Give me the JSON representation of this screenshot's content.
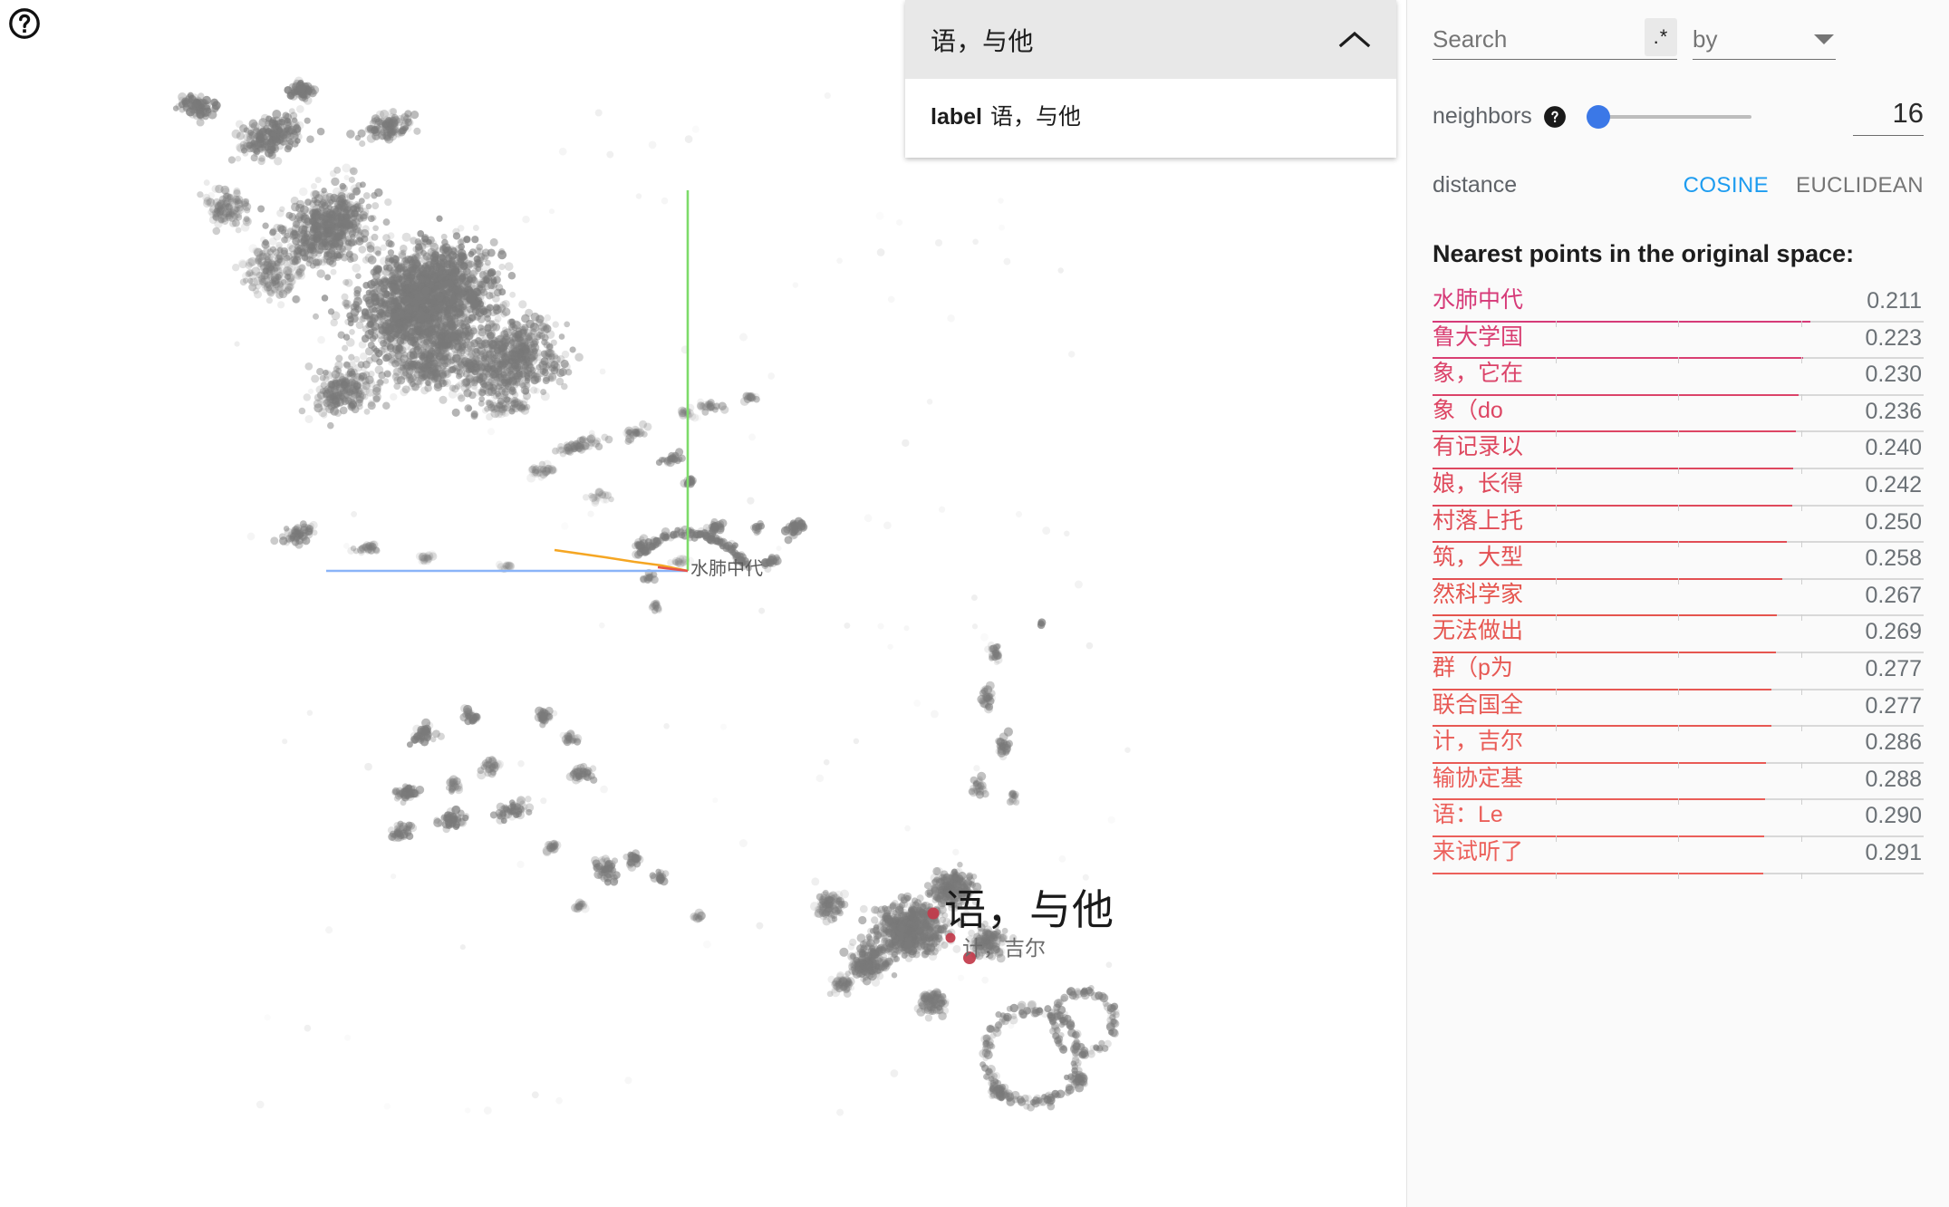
{
  "canvas": {
    "help_icon": "help-circle-icon",
    "selected_point_label": "语，与他",
    "neighbor_point_label": "计，吉尔",
    "axis_origin_label": "水肺中代",
    "axis_colors": {
      "x": "#8ab4f8",
      "y": "#7ddb6a",
      "z": "#f5a623"
    },
    "point_color": "#7a7a7a",
    "highlight_color": "#c2394a"
  },
  "metadata_card": {
    "title": "语，与他",
    "collapse_icon": "chevron-up-icon",
    "rows": [
      {
        "key": "label",
        "value": "语，与他"
      }
    ]
  },
  "sidebar": {
    "search": {
      "placeholder": "Search",
      "value": "",
      "regex_label": ".*",
      "by_label": "by",
      "caret_icon": "chevron-down-icon"
    },
    "neighbors": {
      "label": "neighbors",
      "help_icon": "help-filled-icon",
      "value": "16",
      "slider_percent": 0
    },
    "distance": {
      "label": "distance",
      "options": [
        {
          "label": "COSINE",
          "active": true
        },
        {
          "label": "EUCLIDEAN",
          "active": false
        }
      ]
    },
    "nearest": {
      "heading": "Nearest points in the original space:",
      "items": [
        {
          "label": "水肺中代",
          "distance": "0.211",
          "bar_percent": 77.0,
          "color": "#d63a78"
        },
        {
          "label": "鲁大学国",
          "distance": "0.223",
          "bar_percent": 75.5,
          "color": "#d93f72"
        },
        {
          "label": "象，它在",
          "distance": "0.230",
          "bar_percent": 74.6,
          "color": "#db4369"
        },
        {
          "label": "象（do",
          "distance": "0.236",
          "bar_percent": 73.9,
          "color": "#dd4664"
        },
        {
          "label": "有记录以",
          "distance": "0.240",
          "bar_percent": 73.4,
          "color": "#de485f"
        },
        {
          "label": "娘，长得",
          "distance": "0.242",
          "bar_percent": 73.2,
          "color": "#df4a5c"
        },
        {
          "label": "村落上托",
          "distance": "0.250",
          "bar_percent": 72.2,
          "color": "#e14d56"
        },
        {
          "label": "筑，大型",
          "distance": "0.258",
          "bar_percent": 71.3,
          "color": "#e35052"
        },
        {
          "label": "然科学家",
          "distance": "0.267",
          "bar_percent": 70.2,
          "color": "#e5544d"
        },
        {
          "label": "无法做出",
          "distance": "0.269",
          "bar_percent": 70.0,
          "color": "#e65650"
        },
        {
          "label": "群（p为",
          "distance": "0.277",
          "bar_percent": 69.0,
          "color": "#e75853"
        },
        {
          "label": "联合国全",
          "distance": "0.277",
          "bar_percent": 69.0,
          "color": "#e75853"
        },
        {
          "label": "计，吉尔",
          "distance": "0.286",
          "bar_percent": 67.9,
          "color": "#e95b56"
        },
        {
          "label": "输协定基",
          "distance": "0.288",
          "bar_percent": 67.7,
          "color": "#ea5d58"
        },
        {
          "label": "语：Le",
          "distance": "0.290",
          "bar_percent": 67.5,
          "color": "#eb5f5a"
        },
        {
          "label": "来试听了",
          "distance": "0.291",
          "bar_percent": 67.4,
          "color": "#ec605b"
        }
      ]
    }
  }
}
